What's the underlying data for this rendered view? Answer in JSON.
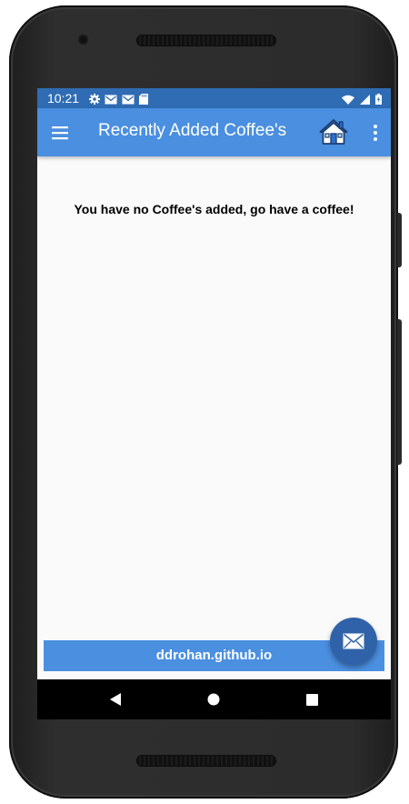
{
  "status_bar": {
    "time": "10:21",
    "left_icons": [
      "settings-icon",
      "mail-icon",
      "mail-icon",
      "sd-card-icon"
    ],
    "right_icons": [
      "wifi-icon",
      "signal-icon",
      "battery-charging-icon"
    ],
    "color": "#2f6cb3"
  },
  "app_bar": {
    "title": "Recently Added Coffee's",
    "menu_icon": "hamburger-menu-icon",
    "home_icon": "home-icon",
    "overflow_icon": "more-vert-icon",
    "color": "#4a8fe0"
  },
  "main": {
    "empty_message": "You have no Coffee's added, go have a coffee!"
  },
  "footer": {
    "text": "ddrohan.github.io",
    "color": "#4a8fe0"
  },
  "fab": {
    "icon": "email-icon",
    "color": "#2f62a8"
  },
  "nav_bar": {
    "back_icon": "back-triangle-icon",
    "home_icon": "home-circle-icon",
    "recents_icon": "recents-square-icon"
  }
}
